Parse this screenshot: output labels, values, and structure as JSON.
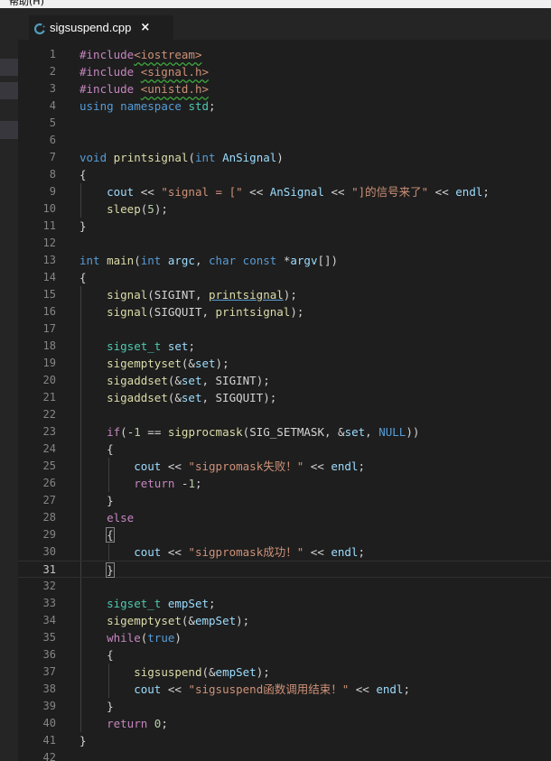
{
  "menubar": {
    "help_label": "帮助(H)"
  },
  "tab": {
    "filename": "sigsuspend.cpp",
    "close_glyph": "×",
    "icon": "c++-file-icon"
  },
  "editor": {
    "current_line": 31,
    "lines": [
      {
        "n": "1",
        "tokens": [
          [
            "pp",
            "#include"
          ],
          [
            "inc",
            "<iostream>"
          ]
        ]
      },
      {
        "n": "2",
        "tokens": [
          [
            "pp",
            "#include "
          ],
          [
            "inc",
            "<signal.h>"
          ]
        ]
      },
      {
        "n": "3",
        "tokens": [
          [
            "pp",
            "#include "
          ],
          [
            "inc",
            "<unistd.h>"
          ]
        ]
      },
      {
        "n": "4",
        "tokens": [
          [
            "kw",
            "using"
          ],
          [
            "pl",
            " "
          ],
          [
            "kw",
            "namespace"
          ],
          [
            "pl",
            " "
          ],
          [
            "ty",
            "std"
          ],
          [
            "pl",
            ";"
          ]
        ]
      },
      {
        "n": "5",
        "tokens": []
      },
      {
        "n": "6",
        "tokens": []
      },
      {
        "n": "7",
        "tokens": [
          [
            "kw",
            "void"
          ],
          [
            "pl",
            " "
          ],
          [
            "fn",
            "printsignal"
          ],
          [
            "pl",
            "("
          ],
          [
            "kw",
            "int"
          ],
          [
            "pl",
            " "
          ],
          [
            "var",
            "AnSignal"
          ],
          [
            "pl",
            ")"
          ]
        ]
      },
      {
        "n": "8",
        "tokens": [
          [
            "pl",
            "{"
          ]
        ]
      },
      {
        "n": "9",
        "tokens": [
          [
            "pl",
            "    "
          ],
          [
            "var",
            "cout"
          ],
          [
            "pl",
            " << "
          ],
          [
            "str",
            "\"signal = [\""
          ],
          [
            "pl",
            " << "
          ],
          [
            "var",
            "AnSignal"
          ],
          [
            "pl",
            " << "
          ],
          [
            "str",
            "\"]的信号来了\""
          ],
          [
            "pl",
            " << "
          ],
          [
            "var",
            "endl"
          ],
          [
            "pl",
            ";"
          ]
        ]
      },
      {
        "n": "10",
        "tokens": [
          [
            "pl",
            "    "
          ],
          [
            "fn",
            "sleep"
          ],
          [
            "pl",
            "("
          ],
          [
            "num",
            "5"
          ],
          [
            "pl",
            ");"
          ]
        ]
      },
      {
        "n": "11",
        "tokens": [
          [
            "pl",
            "}"
          ]
        ]
      },
      {
        "n": "12",
        "tokens": []
      },
      {
        "n": "13",
        "tokens": [
          [
            "kw",
            "int"
          ],
          [
            "pl",
            " "
          ],
          [
            "fn",
            "main"
          ],
          [
            "pl",
            "("
          ],
          [
            "kw",
            "int"
          ],
          [
            "pl",
            " "
          ],
          [
            "var",
            "argc"
          ],
          [
            "pl",
            ", "
          ],
          [
            "kw",
            "char"
          ],
          [
            "pl",
            " "
          ],
          [
            "kw",
            "const"
          ],
          [
            "pl",
            " *"
          ],
          [
            "var",
            "argv"
          ],
          [
            "pl",
            "[])"
          ]
        ]
      },
      {
        "n": "14",
        "tokens": [
          [
            "pl",
            "{"
          ]
        ]
      },
      {
        "n": "15",
        "tokens": [
          [
            "pl",
            "    "
          ],
          [
            "fn",
            "signal"
          ],
          [
            "pl",
            "(SIGINT, "
          ],
          [
            "fnref",
            "printsignal"
          ],
          [
            "pl",
            ");"
          ]
        ]
      },
      {
        "n": "16",
        "tokens": [
          [
            "pl",
            "    "
          ],
          [
            "fn",
            "signal"
          ],
          [
            "pl",
            "(SIGQUIT, "
          ],
          [
            "fn",
            "printsignal"
          ],
          [
            "pl",
            ");"
          ]
        ]
      },
      {
        "n": "17",
        "tokens": []
      },
      {
        "n": "18",
        "tokens": [
          [
            "pl",
            "    "
          ],
          [
            "ty",
            "sigset_t"
          ],
          [
            "pl",
            " "
          ],
          [
            "var",
            "set"
          ],
          [
            "pl",
            ";"
          ]
        ]
      },
      {
        "n": "19",
        "tokens": [
          [
            "pl",
            "    "
          ],
          [
            "fn",
            "sigemptyset"
          ],
          [
            "pl",
            "(&"
          ],
          [
            "var",
            "set"
          ],
          [
            "pl",
            ");"
          ]
        ]
      },
      {
        "n": "20",
        "tokens": [
          [
            "pl",
            "    "
          ],
          [
            "fn",
            "sigaddset"
          ],
          [
            "pl",
            "(&"
          ],
          [
            "var",
            "set"
          ],
          [
            "pl",
            ", SIGINT);"
          ]
        ]
      },
      {
        "n": "21",
        "tokens": [
          [
            "pl",
            "    "
          ],
          [
            "fn",
            "sigaddset"
          ],
          [
            "pl",
            "(&"
          ],
          [
            "var",
            "set"
          ],
          [
            "pl",
            ", SIGQUIT);"
          ]
        ]
      },
      {
        "n": "22",
        "tokens": []
      },
      {
        "n": "23",
        "tokens": [
          [
            "pl",
            "    "
          ],
          [
            "ctl",
            "if"
          ],
          [
            "pl",
            "(-"
          ],
          [
            "num",
            "1"
          ],
          [
            "pl",
            " == "
          ],
          [
            "fn",
            "sigprocmask"
          ],
          [
            "pl",
            "(SIG_SETMASK, &"
          ],
          [
            "var",
            "set"
          ],
          [
            "pl",
            ", "
          ],
          [
            "kw",
            "NULL"
          ],
          [
            "pl",
            "))"
          ]
        ]
      },
      {
        "n": "24",
        "tokens": [
          [
            "pl",
            "    {"
          ]
        ]
      },
      {
        "n": "25",
        "tokens": [
          [
            "pl",
            "        "
          ],
          [
            "var",
            "cout"
          ],
          [
            "pl",
            " << "
          ],
          [
            "str",
            "\"sigpromask失败！\""
          ],
          [
            "pl",
            " << "
          ],
          [
            "var",
            "endl"
          ],
          [
            "pl",
            ";"
          ]
        ]
      },
      {
        "n": "26",
        "tokens": [
          [
            "pl",
            "        "
          ],
          [
            "ctl",
            "return"
          ],
          [
            "pl",
            " -"
          ],
          [
            "num",
            "1"
          ],
          [
            "pl",
            ";"
          ]
        ]
      },
      {
        "n": "27",
        "tokens": [
          [
            "pl",
            "    }"
          ]
        ]
      },
      {
        "n": "28",
        "tokens": [
          [
            "pl",
            "    "
          ],
          [
            "ctl",
            "else"
          ]
        ]
      },
      {
        "n": "29",
        "tokens": [
          [
            "pl",
            "    "
          ],
          [
            "box",
            "{"
          ]
        ]
      },
      {
        "n": "30",
        "tokens": [
          [
            "pl",
            "        "
          ],
          [
            "var",
            "cout"
          ],
          [
            "pl",
            " << "
          ],
          [
            "str",
            "\"sigpromask成功！\""
          ],
          [
            "pl",
            " << "
          ],
          [
            "var",
            "endl"
          ],
          [
            "pl",
            ";"
          ]
        ]
      },
      {
        "n": "31",
        "tokens": [
          [
            "pl",
            "    "
          ],
          [
            "box",
            "}"
          ]
        ]
      },
      {
        "n": "32",
        "tokens": []
      },
      {
        "n": "33",
        "tokens": [
          [
            "pl",
            "    "
          ],
          [
            "ty",
            "sigset_t"
          ],
          [
            "pl",
            " "
          ],
          [
            "var",
            "empSet"
          ],
          [
            "pl",
            ";"
          ]
        ]
      },
      {
        "n": "34",
        "tokens": [
          [
            "pl",
            "    "
          ],
          [
            "fn",
            "sigemptyset"
          ],
          [
            "pl",
            "(&"
          ],
          [
            "var",
            "empSet"
          ],
          [
            "pl",
            ");"
          ]
        ]
      },
      {
        "n": "35",
        "tokens": [
          [
            "pl",
            "    "
          ],
          [
            "ctl",
            "while"
          ],
          [
            "pl",
            "("
          ],
          [
            "kw",
            "true"
          ],
          [
            "pl",
            ")"
          ]
        ]
      },
      {
        "n": "36",
        "tokens": [
          [
            "pl",
            "    {"
          ]
        ]
      },
      {
        "n": "37",
        "tokens": [
          [
            "pl",
            "        "
          ],
          [
            "fn",
            "sigsuspend"
          ],
          [
            "pl",
            "(&"
          ],
          [
            "var",
            "empSet"
          ],
          [
            "pl",
            ");"
          ]
        ]
      },
      {
        "n": "38",
        "tokens": [
          [
            "pl",
            "        "
          ],
          [
            "var",
            "cout"
          ],
          [
            "pl",
            " << "
          ],
          [
            "str",
            "\"sigsuspend函数调用结束！\""
          ],
          [
            "pl",
            " << "
          ],
          [
            "var",
            "endl"
          ],
          [
            "pl",
            ";"
          ]
        ]
      },
      {
        "n": "39",
        "tokens": [
          [
            "pl",
            "    }"
          ]
        ]
      },
      {
        "n": "40",
        "tokens": [
          [
            "pl",
            "    "
          ],
          [
            "ctl",
            "return"
          ],
          [
            "pl",
            " "
          ],
          [
            "num",
            "0"
          ],
          [
            "pl",
            ";"
          ]
        ]
      },
      {
        "n": "41",
        "tokens": [
          [
            "pl",
            "}"
          ]
        ]
      },
      {
        "n": "42",
        "tokens": []
      }
    ]
  }
}
